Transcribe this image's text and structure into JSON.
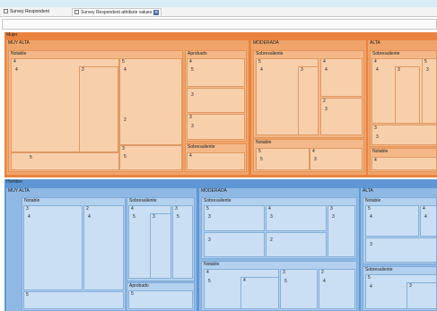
{
  "tabs": [
    {
      "label": "Survey Respondent"
    },
    {
      "label": "Survey Respondent attribute values",
      "close_icon": "✕"
    }
  ],
  "treemap": {
    "mujer": {
      "label": "Mujer",
      "muy_alta": {
        "label": "MUY ALTA",
        "notable": {
          "label": "Notable",
          "leaves": [
            "4",
            "2",
            "4",
            "5",
            "5",
            "2",
            "3",
            "5"
          ]
        },
        "aprobado": {
          "label": "Aprobado",
          "leaves": [
            "4",
            "5",
            "3",
            "3",
            "3"
          ]
        },
        "sobresaliente": {
          "label": "Sobresaliente",
          "leaves": [
            "4"
          ]
        }
      },
      "moderada": {
        "label": "MODERADA",
        "sobresaliente": {
          "label": "Sobresaliente",
          "leaves": [
            "5",
            "4",
            "3",
            "4",
            "4",
            "2",
            "3"
          ]
        },
        "notable": {
          "label": "Notable",
          "leaves": [
            "5",
            "5",
            "4",
            "3"
          ]
        }
      },
      "alta": {
        "label": "ALTA",
        "sobresaliente": {
          "label": "Sobresaliente",
          "leaves": [
            "4",
            "4",
            "3",
            "5",
            "3",
            "3",
            "3"
          ]
        },
        "notable": {
          "label": "Notable",
          "leaves": [
            "4"
          ]
        }
      }
    },
    "hombre": {
      "label": "Hombre",
      "muy_alta": {
        "label": "MUY ALTA",
        "notable": {
          "label": "Notable",
          "leaves": [
            "3",
            "4",
            "2",
            "4",
            "5"
          ]
        },
        "sobresaliente": {
          "label": "Sobresaliente",
          "leaves": [
            "4",
            "5",
            "3",
            "3",
            "5"
          ]
        },
        "aprobado": {
          "label": "Aprobado",
          "leaves": [
            "5"
          ]
        }
      },
      "moderada": {
        "label": "MODERADA",
        "sobresaliente": {
          "label": "Sobresaliente",
          "leaves": [
            "5",
            "3",
            "4",
            "3",
            "3",
            "2"
          ]
        },
        "notable": {
          "label": "Notable",
          "leaves": [
            "4",
            "3",
            "2",
            "5",
            "4",
            "5",
            "4"
          ]
        }
      },
      "alta": {
        "label": "ALTA",
        "notable": {
          "label": "Notable",
          "leaves": [
            "5",
            "4",
            "4",
            "3"
          ]
        },
        "sobresaliente": {
          "label": "Sobresaliente",
          "leaves": [
            "5",
            "4",
            "3"
          ]
        }
      }
    }
  }
}
